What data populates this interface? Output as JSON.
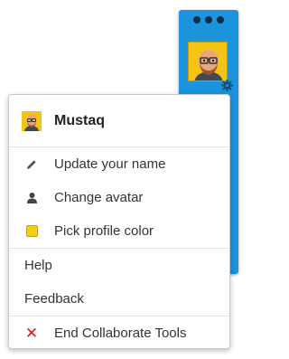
{
  "panel": {
    "accent_color": "#1b93dd",
    "dots_icon": "more-dots-icon",
    "avatar_icon": "user-avatar",
    "gear_icon": "gear-icon"
  },
  "menu": {
    "user": {
      "name": "Mustaq",
      "avatar_icon": "user-avatar"
    },
    "profile_items": [
      {
        "label": "Update your name",
        "icon": "pencil-icon"
      },
      {
        "label": "Change avatar",
        "icon": "person-icon"
      },
      {
        "label": "Pick profile color",
        "icon": "color-swatch",
        "color": "#f5cf0b"
      }
    ],
    "links": [
      {
        "label": "Help"
      },
      {
        "label": "Feedback"
      }
    ],
    "exit": {
      "label": "End Collaborate Tools",
      "icon": "close-icon",
      "color": "#e0141e"
    }
  }
}
